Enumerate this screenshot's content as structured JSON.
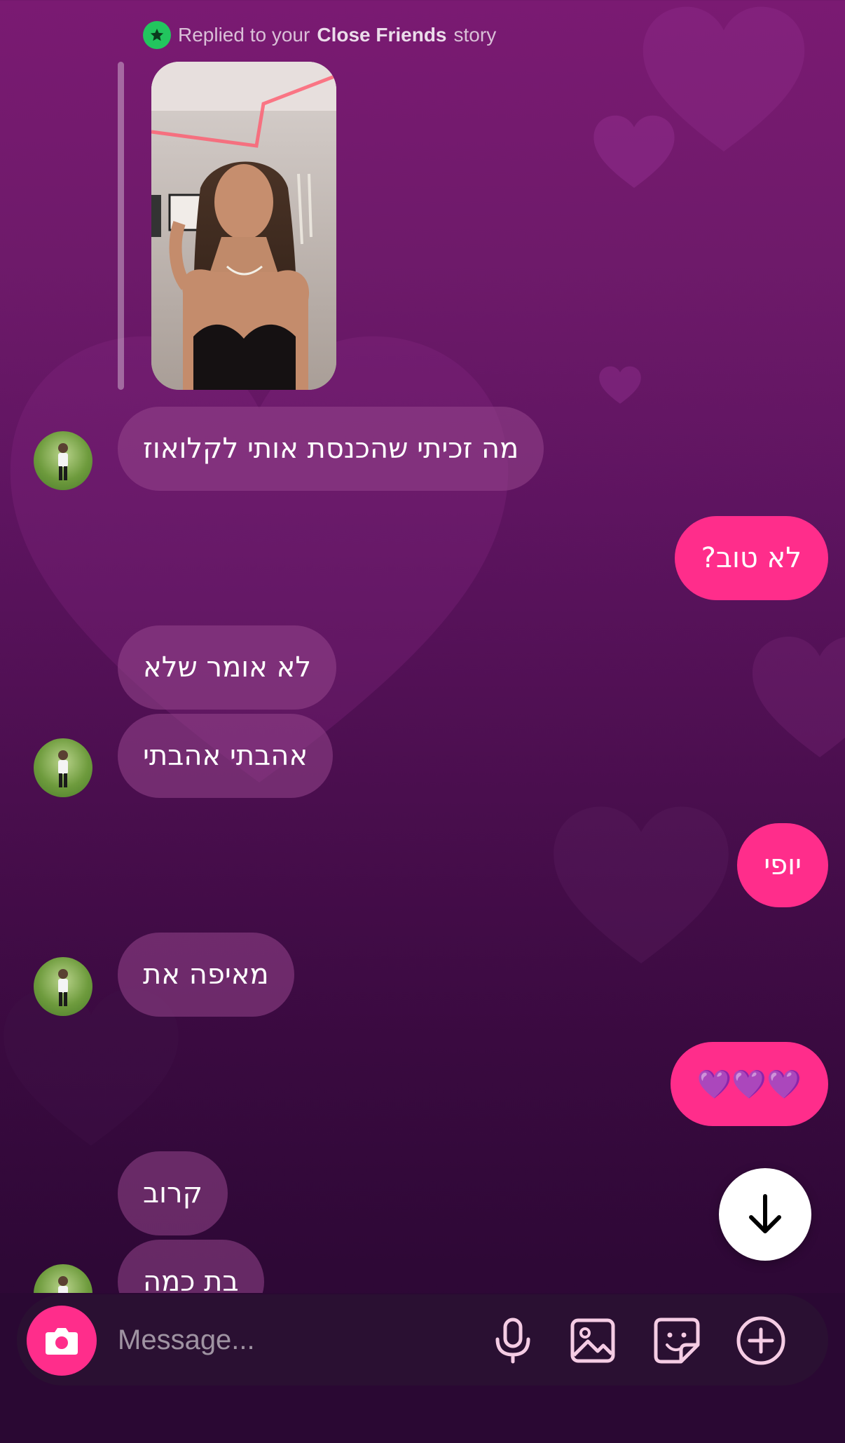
{
  "reply_header": {
    "prefix": "Replied to your",
    "highlight": "Close Friends",
    "suffix": "story",
    "icon": "close-friends-star-icon"
  },
  "messages": [
    {
      "id": "m1",
      "direction": "incoming",
      "text": "מה זכיתי שהכנסת אותי לקלואוז"
    },
    {
      "id": "m2",
      "direction": "outgoing",
      "text": "לא טוב?"
    },
    {
      "id": "m3",
      "direction": "incoming",
      "text": "לא אומר שלא"
    },
    {
      "id": "m4",
      "direction": "incoming",
      "text": "אהבתי אהבתי"
    },
    {
      "id": "m5",
      "direction": "outgoing",
      "text": "יופי"
    },
    {
      "id": "m6",
      "direction": "incoming",
      "text": "מאיפה את"
    },
    {
      "id": "m7",
      "direction": "outgoing",
      "text": "💜💜💜"
    },
    {
      "id": "m8",
      "direction": "incoming",
      "text": "קרוב"
    },
    {
      "id": "m9",
      "direction": "incoming",
      "text": "בת כמה"
    }
  ],
  "composer": {
    "placeholder": "Message...",
    "icons": [
      "camera-icon",
      "microphone-icon",
      "gallery-icon",
      "sticker-icon",
      "add-icon"
    ]
  },
  "colors": {
    "outgoing_bubble": "#ff2d8b",
    "incoming_bubble": "#96468c",
    "accent_green": "#22c55e"
  }
}
